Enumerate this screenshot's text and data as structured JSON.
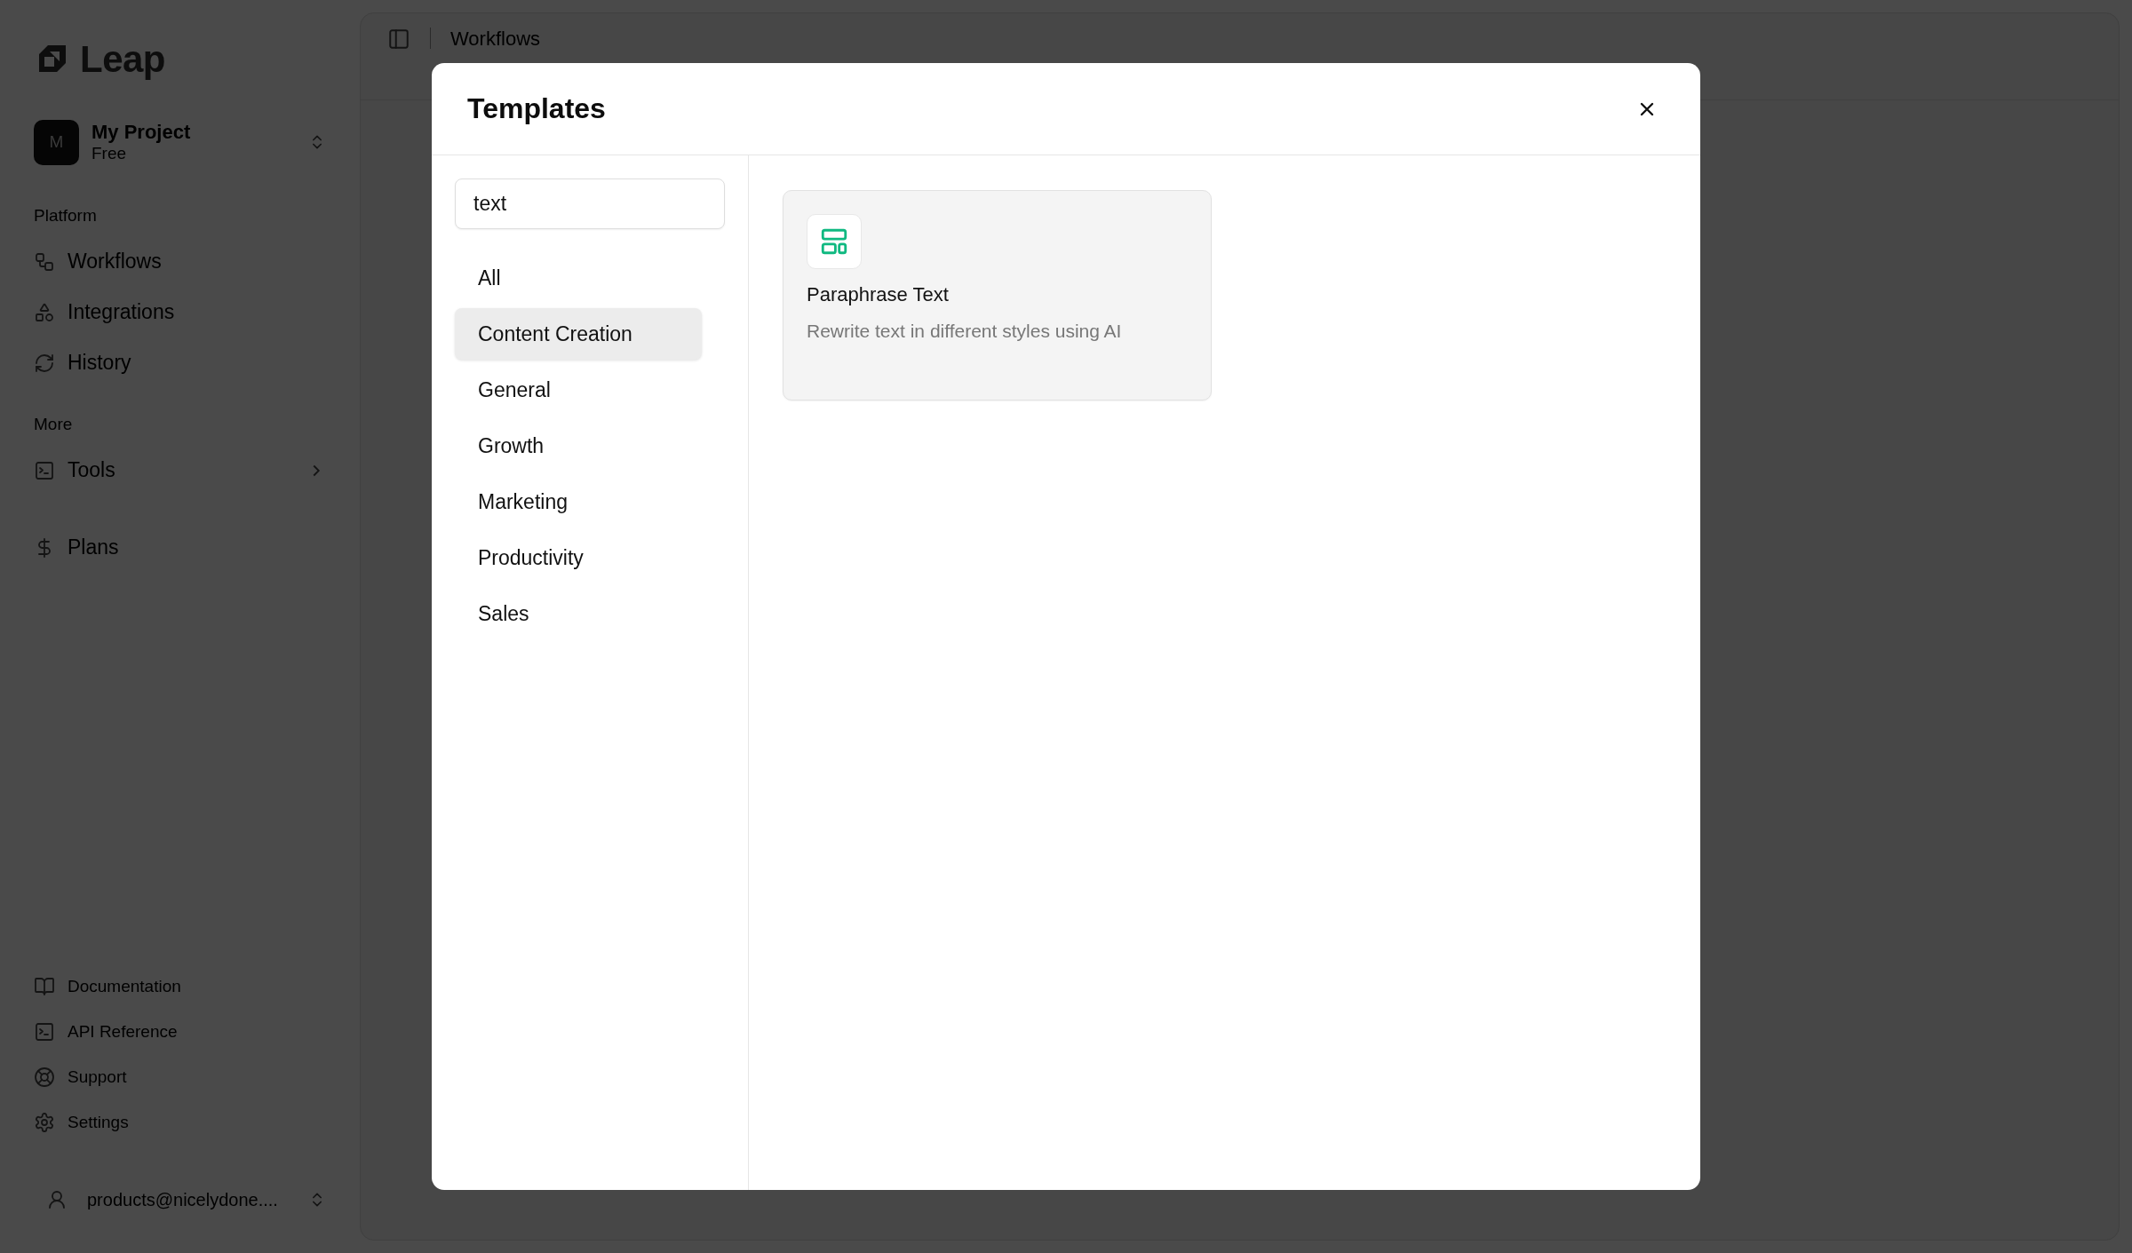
{
  "sidebar": {
    "logo": "Leap",
    "project": {
      "initial": "M",
      "name": "My Project",
      "plan": "Free"
    },
    "sections": [
      {
        "label": "Platform",
        "items": [
          {
            "label": "Workflows",
            "expandable": false
          },
          {
            "label": "Integrations",
            "expandable": false
          },
          {
            "label": "History",
            "expandable": false
          }
        ]
      },
      {
        "label": "More",
        "items": [
          {
            "label": "Tools",
            "expandable": true
          }
        ]
      },
      {
        "items": [
          {
            "label": "Plans",
            "expandable": false
          }
        ]
      }
    ],
    "footer_items": [
      {
        "label": "Documentation"
      },
      {
        "label": "API Reference"
      },
      {
        "label": "Support"
      },
      {
        "label": "Settings"
      }
    ],
    "user": "products@nicelydone...."
  },
  "header": {
    "breadcrumb": "Workflows"
  },
  "dialog": {
    "title": "Templates",
    "search": {
      "value": "text"
    },
    "categories": [
      {
        "label": "All",
        "selected": false
      },
      {
        "label": "Content Creation",
        "selected": true
      },
      {
        "label": "General",
        "selected": false
      },
      {
        "label": "Growth",
        "selected": false
      },
      {
        "label": "Marketing",
        "selected": false
      },
      {
        "label": "Productivity",
        "selected": false
      },
      {
        "label": "Sales",
        "selected": false
      }
    ],
    "templates": [
      {
        "title": "Paraphrase Text",
        "description": "Rewrite text in different styles using AI"
      }
    ]
  }
}
